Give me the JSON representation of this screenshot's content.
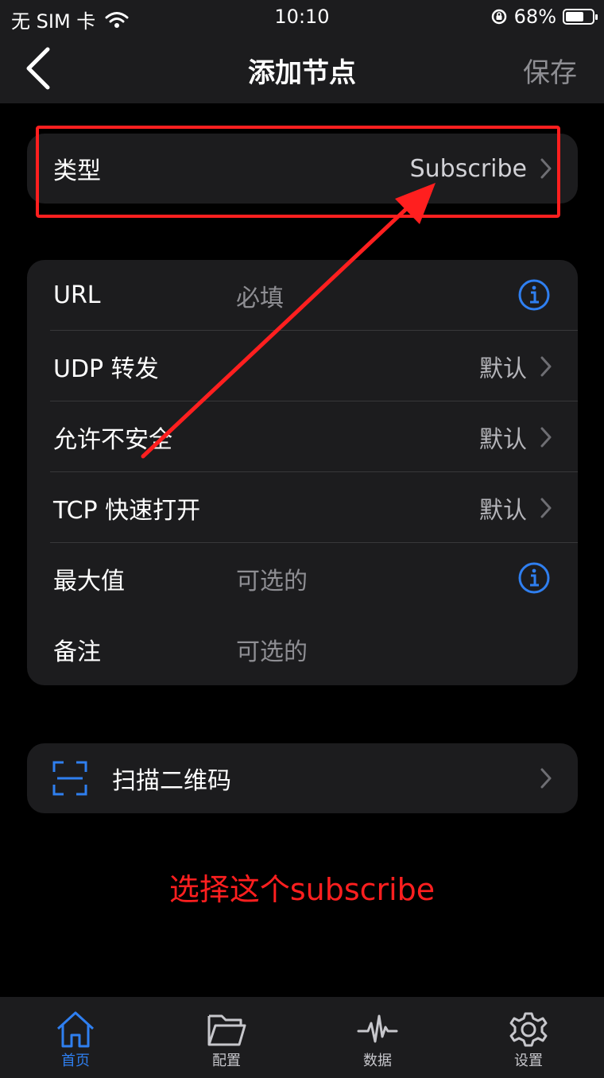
{
  "status_bar": {
    "carrier": "无 SIM 卡",
    "time": "10:10",
    "battery_percent": "68%",
    "battery_level": 0.68
  },
  "nav": {
    "title": "添加节点",
    "save_label": "保存",
    "back_icon": "chevron-left-icon"
  },
  "type_group": {
    "label": "类型",
    "value": "Subscribe"
  },
  "settings_group": {
    "rows": [
      {
        "label": "URL",
        "placeholder": "必填",
        "accessory": "info-icon"
      },
      {
        "label": "UDP 转发",
        "value": "默认",
        "accessory": "chevron-right-icon"
      },
      {
        "label": "允许不安全",
        "value": "默认",
        "accessory": "chevron-right-icon"
      },
      {
        "label": "TCP 快速打开",
        "value": "默认",
        "accessory": "chevron-right-icon"
      },
      {
        "label": "最大值",
        "placeholder": "可选的",
        "accessory": "info-icon"
      },
      {
        "label": "备注",
        "placeholder": "可选的"
      }
    ]
  },
  "scan_group": {
    "label": "扫描二维码",
    "icon": "qr-scan-icon"
  },
  "annotation": {
    "text": "选择这个subscribe"
  },
  "tab_bar": {
    "tabs": [
      {
        "label": "首页",
        "icon": "home-icon",
        "active": true
      },
      {
        "label": "配置",
        "icon": "folder-icon",
        "active": false
      },
      {
        "label": "数据",
        "icon": "activity-icon",
        "active": false
      },
      {
        "label": "设置",
        "icon": "gear-icon",
        "active": false
      }
    ]
  },
  "colors": {
    "accent": "#2f7ff0",
    "annotation": "#ff1f1f",
    "background": "#000000",
    "surface": "#1c1c1e"
  }
}
